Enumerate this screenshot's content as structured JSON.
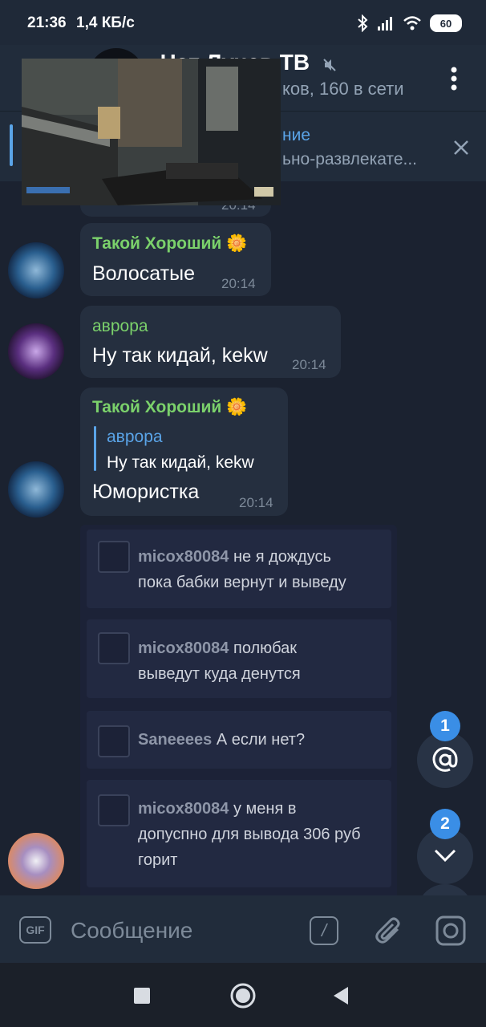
{
  "status_bar": {
    "time": "21:36",
    "speed": "1,4 КБ/с",
    "battery": "60"
  },
  "header": {
    "title": "Чат Лучев ТВ",
    "subtitle": "ков, 160 в сети"
  },
  "pinned": {
    "title": "ние",
    "text": "ьно-развлекате..."
  },
  "previous_message_time": "20:14",
  "messages": [
    {
      "author": "Такой Хороший 🌼",
      "text": "Волосатые",
      "time": "20:14"
    },
    {
      "author": "аврора",
      "text": "Ну так кидай, kekw",
      "time": "20:14"
    },
    {
      "author": "Такой Хороший 🌼",
      "reply_author": "аврора",
      "reply_text": "Ну так кидай, kekw",
      "text": "Юмористка",
      "time": "20:14"
    }
  ],
  "image_comments": [
    {
      "user": "micox80084",
      "line1": "не я дождусь",
      "line2": "пока бабки вернут и выведу",
      "line3": ""
    },
    {
      "user": "micox80084",
      "line1": "полюбак",
      "line2": "выведут куда денутся",
      "line3": ""
    },
    {
      "user": "Saneeees",
      "line1": "А если нет?",
      "line2": "",
      "line3": ""
    },
    {
      "user": "micox80084",
      "line1": "у меня в",
      "line2": "допуспно для вывода 306 руб",
      "line3": "горит"
    }
  ],
  "mentions_badge": "1",
  "scroll_down_badge": "2",
  "input": {
    "placeholder": "Сообщение",
    "gif_label": "GIF",
    "command_label": "/"
  },
  "colors": {
    "accent": "#5aa4e8",
    "name_green": "#7bd16b",
    "name_purple_green": "#7bd16b",
    "badge": "#3a8ee6"
  }
}
